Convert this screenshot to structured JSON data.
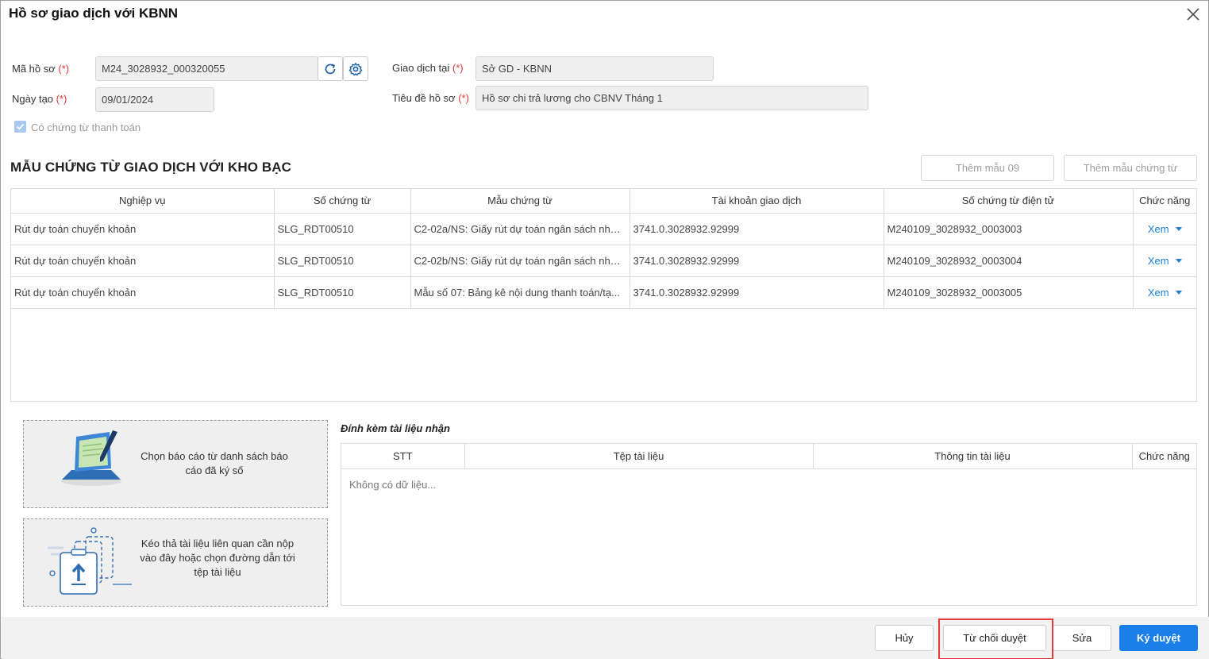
{
  "dialog": {
    "title": "Hồ sơ giao dịch với KBNN"
  },
  "form": {
    "required_mark": "(*)",
    "ma_ho_so_label": "Mã hồ sơ",
    "ma_ho_so_value": "M24_3028932_000320055",
    "ngay_tao_label": "Ngày tạo",
    "ngay_tao_value": "09/01/2024",
    "giao_dich_tai_label": "Giao dịch tại",
    "giao_dich_tai_value": "Sở GD - KBNN",
    "tieu_de_label": "Tiêu đề hồ sơ",
    "tieu_de_value": "Hồ sơ chi trả lương cho CBNV Tháng 1",
    "co_chung_tu_label": "Có chứng từ thanh toán",
    "co_chung_tu_checked": true
  },
  "section": {
    "title": "MẪU CHỨNG TỪ GIAO DỊCH VỚI KHO BẠC",
    "add_mau09_label": "Thêm mẫu 09",
    "add_mau_label": "Thêm mẫu chứng từ"
  },
  "grid": {
    "columns": [
      "Nghiệp vụ",
      "Số chứng từ",
      "Mẫu chứng từ",
      "Tài khoản giao dịch",
      "Số chứng từ điện tử",
      "Chức năng"
    ],
    "rows": [
      {
        "nghiep_vu": "Rút dự toán chuyển khoản",
        "so_chung_tu": "SLG_RDT00510",
        "mau": "C2-02a/NS: Giấy rút dự toán ngân sách nhà ...",
        "tai_khoan": "3741.0.3028932.92999",
        "so_dien_tu": "M240109_3028932_0003003",
        "action": "Xem"
      },
      {
        "nghiep_vu": "Rút dự toán chuyển khoản",
        "so_chung_tu": "SLG_RDT00510",
        "mau": "C2-02b/NS: Giấy rút dự toán ngân sách nhà ...",
        "tai_khoan": "3741.0.3028932.92999",
        "so_dien_tu": "M240109_3028932_0003004",
        "action": "Xem"
      },
      {
        "nghiep_vu": "Rút dự toán chuyển khoản",
        "so_chung_tu": "SLG_RDT00510",
        "mau": "Mẫu số 07: Bảng kê nội dung thanh toán/tạ...",
        "tai_khoan": "3741.0.3028932.92999",
        "so_dien_tu": "M240109_3028932_0003005",
        "action": "Xem"
      }
    ]
  },
  "upload": {
    "choose_signed_text": "Chọn báo cáo từ danh sách báo cáo đã ký số",
    "drag_text": "Kéo thả tài liệu liên quan cần nộp vào đây hoặc chọn đường dẫn tới tệp tài liệu"
  },
  "attachments": {
    "title": "Đính kèm tài liệu nhận",
    "columns": [
      "STT",
      "Tệp tài liệu",
      "Thông tin tài liệu",
      "Chức năng"
    ],
    "empty_text": "Không có dữ liệu..."
  },
  "footer": {
    "cancel_label": "Hủy",
    "reject_label": "Từ chối duyệt",
    "edit_label": "Sửa",
    "approve_label": "Ký duyệt"
  },
  "colors": {
    "primary": "#1a7fe8",
    "link": "#1a7fd4",
    "required": "#e53935",
    "highlight": "#e53935"
  }
}
